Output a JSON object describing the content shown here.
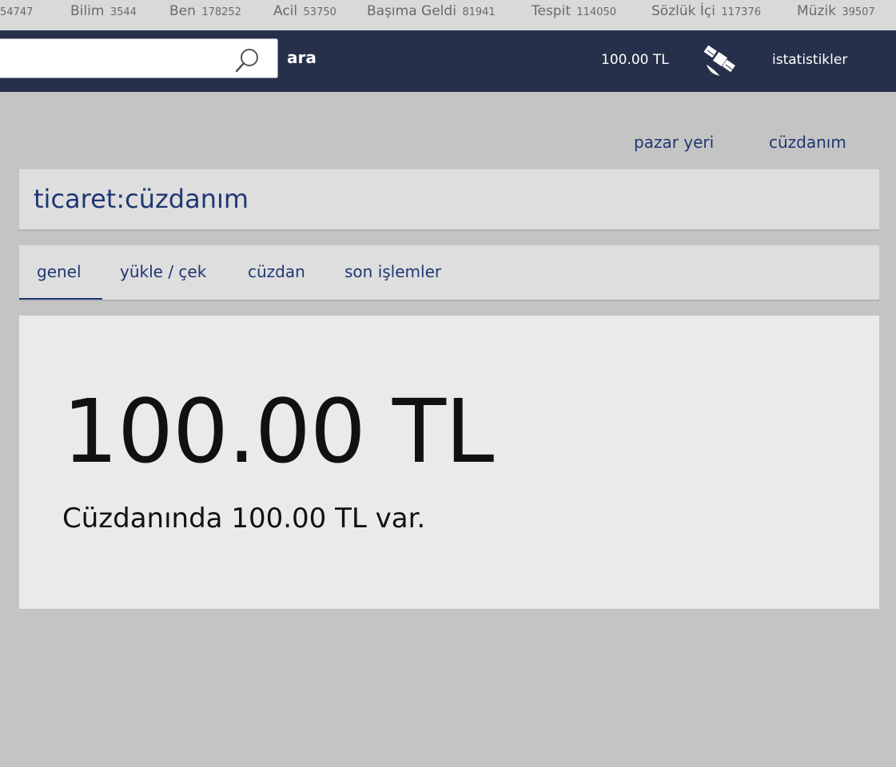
{
  "channels": [
    {
      "name": "",
      "count": "54747"
    },
    {
      "name": "Bilim",
      "count": "3544"
    },
    {
      "name": "Ben",
      "count": "178252"
    },
    {
      "name": "Acil",
      "count": "53750"
    },
    {
      "name": "Başıma Geldi",
      "count": "81941"
    },
    {
      "name": "Tespit",
      "count": "114050"
    },
    {
      "name": "Sözlük İçi",
      "count": "117376"
    },
    {
      "name": "Müzik",
      "count": "39507"
    }
  ],
  "header": {
    "search_value": "",
    "search_placeholder": "",
    "search_label": "ara",
    "balance": "100.00 TL",
    "stats": "istatistikler",
    "search_icon": "search-icon",
    "satellite_icon": "satellite-icon"
  },
  "sub_nav": {
    "market": "pazar yeri",
    "wallet": "cüzdanım"
  },
  "page": {
    "title": "ticaret:cüzdanım"
  },
  "tabs": [
    {
      "label": "genel",
      "active": true
    },
    {
      "label": "yükle / çek",
      "active": false
    },
    {
      "label": "cüzdan",
      "active": false
    },
    {
      "label": "son işlemler",
      "active": false
    }
  ],
  "main": {
    "balance": "100.00 TL",
    "sentence": "Cüzdanında 100.00 TL var."
  },
  "colors": {
    "header_bg": "#26304a",
    "link": "#1f3773",
    "page_bg": "#c4c4c4"
  }
}
